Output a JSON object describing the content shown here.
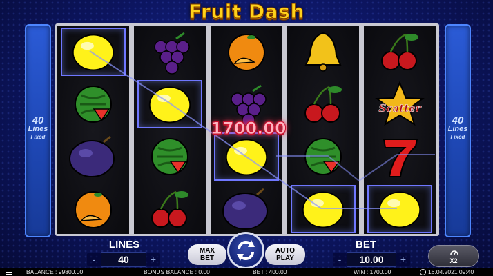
{
  "title": "Fruit Dash",
  "side_panels": {
    "lines_count": "40",
    "lines_word": "Lines",
    "fixed_word": "Fixed"
  },
  "reels": [
    [
      "lemon",
      "watermelon",
      "plum",
      "orange"
    ],
    [
      "grapes",
      "lemon",
      "watermelon",
      "cherries"
    ],
    [
      "orange",
      "grapes",
      "lemon",
      "plum"
    ],
    [
      "bell",
      "cherries",
      "watermelon",
      "lemon"
    ],
    [
      "cherries",
      "scatter",
      "seven",
      "lemon"
    ]
  ],
  "winning_symbols": [
    "reel1-row1",
    "reel2-row2",
    "reel3-row3",
    "reel4-row4",
    "reel5-row4"
  ],
  "scatter_text": "Scatter",
  "win_amount": "1700.00",
  "controls": {
    "lines_label": "LINES",
    "lines_value": "40",
    "bet_label": "BET",
    "bet_value": "10.00",
    "minus": "-",
    "plus": "+",
    "max_bet_line1": "MAX",
    "max_bet_line2": "BET",
    "auto_play_line1": "AUTO",
    "auto_play_line2": "PLAY",
    "speed_label": "X2"
  },
  "status": {
    "balance": "BALANCE : 99800.00",
    "bonus_balance": "BONUS BALANCE : 0.00",
    "bet": "BET : 400.00",
    "win": "WIN : 1700.00",
    "datetime": "16.04.2021 09:40"
  },
  "colors": {
    "background": "#0c1560",
    "title": "#ffd21a",
    "win_frame": "#6f77ff",
    "win_amount": "#ff3050",
    "side_panel": "#1f49b8"
  }
}
